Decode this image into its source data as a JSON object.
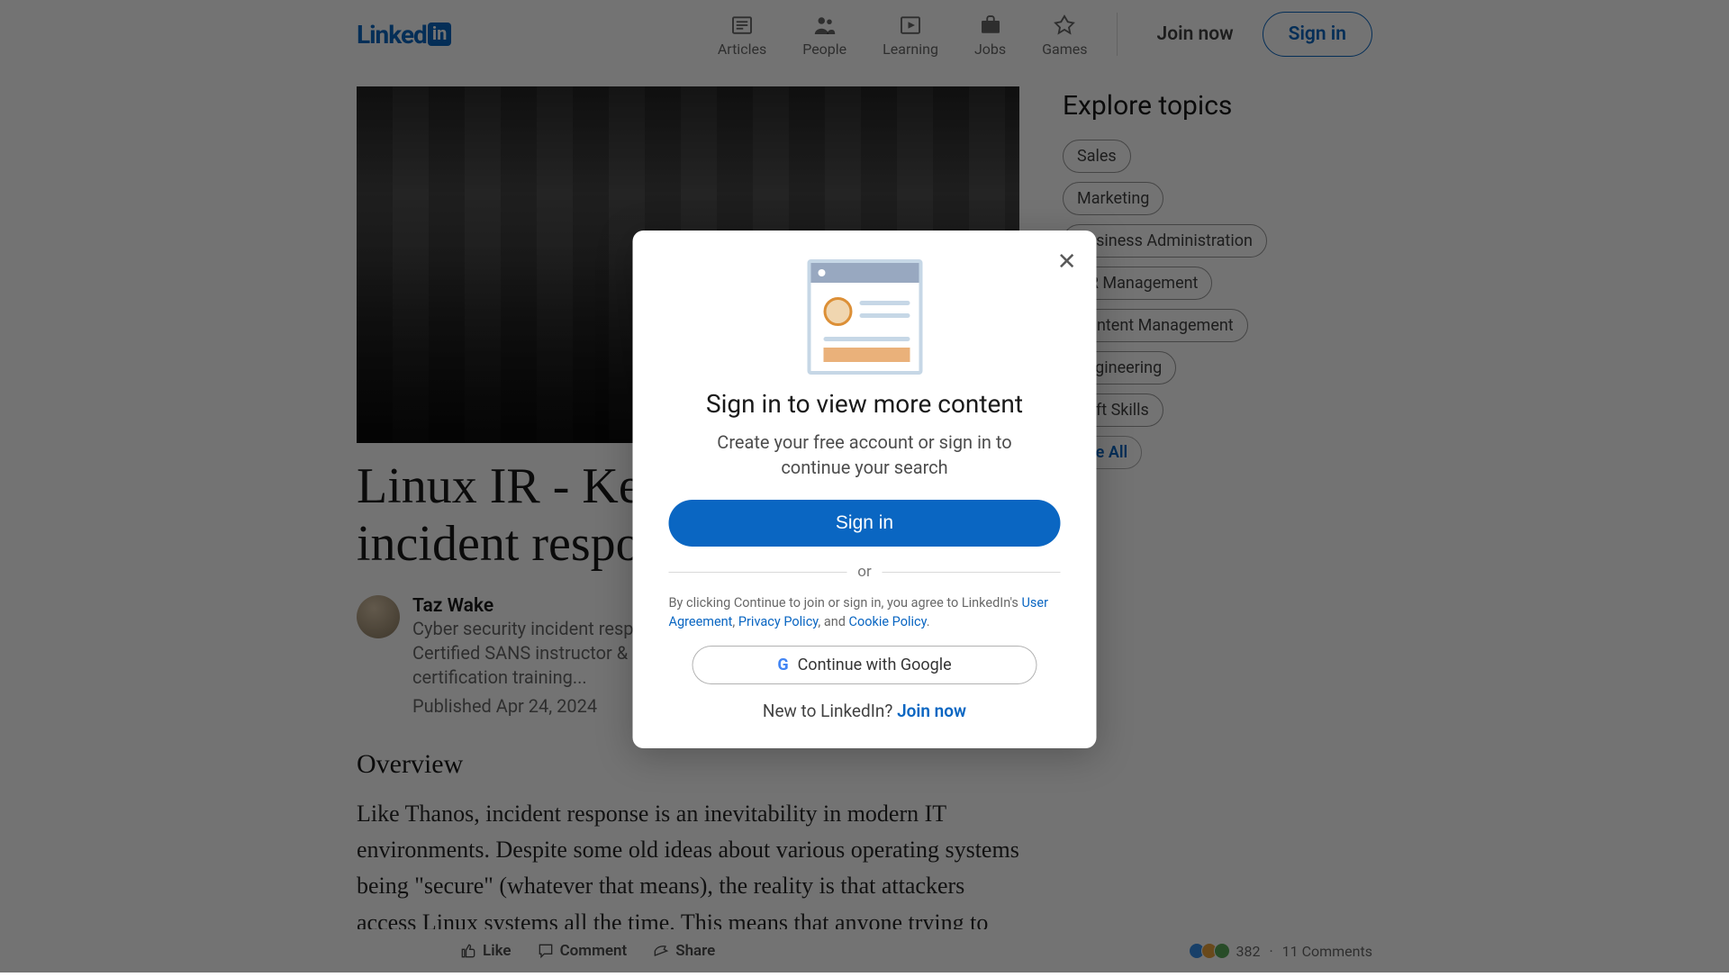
{
  "brand": {
    "name": "Linked",
    "badge": "in"
  },
  "nav": {
    "items": [
      {
        "label": "Articles"
      },
      {
        "label": "People"
      },
      {
        "label": "Learning"
      },
      {
        "label": "Jobs"
      },
      {
        "label": "Games"
      }
    ],
    "join": "Join now",
    "signin": "Sign in"
  },
  "article": {
    "title": "Linux IR - Key artifacts for incident responders",
    "author": {
      "name": "Taz Wake",
      "desc": "Cyber security incident response | Threat hunting | Digital forensics | Certified SANS instructor & course author | GSE | I am not looking for paid certification training...",
      "pubdate": "Published Apr 24, 2024"
    },
    "section_title": "Overview",
    "body_para": "Like Thanos, incident response is an inevitability in modern IT environments. Despite some old ideas about various operating systems being \"secure\" (whatever that means), the reality is that attackers access Linux systems all the time. This means that anyone trying to deal with an attack - from formal IR"
  },
  "aside": {
    "title": "Explore topics",
    "topics": [
      "Sales",
      "Marketing",
      "Business Administration",
      "HR Management",
      "Content Management",
      "Engineering",
      "Soft Skills"
    ],
    "see_all": "See All"
  },
  "social": {
    "like": "Like",
    "comment": "Comment",
    "share": "Share",
    "reactions": "382",
    "comments": "11 Comments"
  },
  "modal": {
    "title": "Sign in to view more content",
    "subtitle": "Create your free account or sign in to continue your search",
    "signin_btn": "Sign in",
    "or": "or",
    "legal_prefix": "By clicking Continue to join or sign in, you agree to LinkedIn's ",
    "user_agreement": "User Agreement",
    "comma1": ", ",
    "privacy": "Privacy Policy",
    "and": ", and ",
    "cookie": "Cookie Policy",
    "period": ".",
    "google": "Continue with Google",
    "new_prefix": "New to LinkedIn? ",
    "join": "Join now"
  }
}
